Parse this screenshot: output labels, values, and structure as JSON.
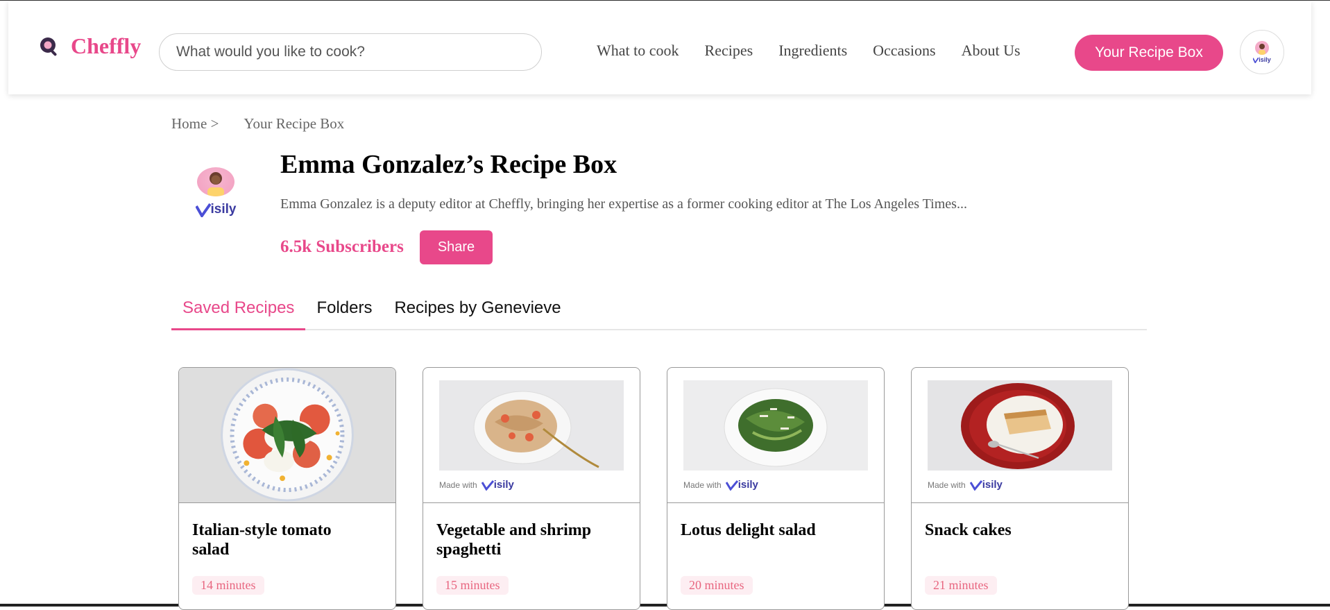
{
  "header": {
    "brand": "Cheffly",
    "search_placeholder": "What would you like to cook?",
    "nav": [
      "What to cook",
      "Recipes",
      "Ingredients",
      "Occasions",
      "About Us"
    ],
    "recipe_box_button": "Your Recipe Box"
  },
  "breadcrumb": {
    "home": "Home >",
    "current": "Your Recipe Box"
  },
  "profile": {
    "name": "Emma Gonzalez’s Recipe Box",
    "bio": "Emma Gonzalez is a deputy editor at Cheffly, bringing her expertise as a former cooking editor at The Los Angeles Times...",
    "subscribers": "6.5k Subscribers",
    "share_label": "Share",
    "watermark": "visily"
  },
  "tabs": [
    "Saved Recipes",
    "Folders",
    "Recipes by Genevieve"
  ],
  "made_with": "Made with",
  "cards": [
    {
      "title": "Italian-style tomato salad",
      "time": "14 minutes"
    },
    {
      "title": "Vegetable and shrimp spaghetti",
      "time": "15 minutes"
    },
    {
      "title": "Lotus delight salad",
      "time": "20 minutes"
    },
    {
      "title": "Snack cakes",
      "time": "21 minutes"
    }
  ],
  "colors": {
    "accent": "#e8488a",
    "badge_bg": "#fdeef2",
    "badge_text": "#e8657f"
  }
}
